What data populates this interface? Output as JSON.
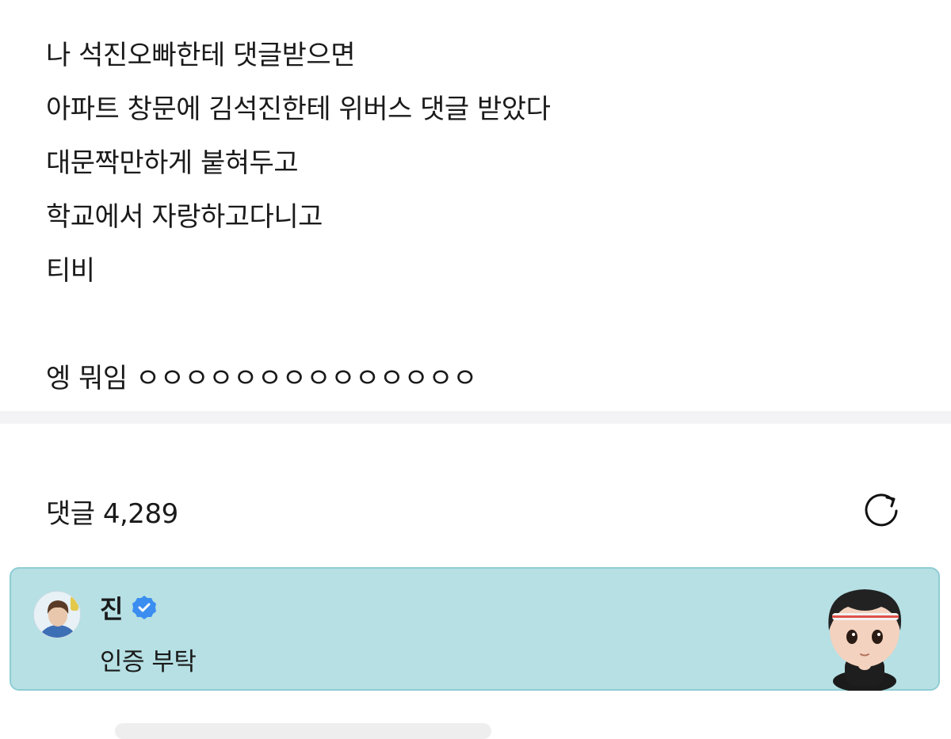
{
  "post": {
    "lines": [
      "나 석진오빠한테 댓글받으면",
      "아파트 창문에 김석진한테 위버스 댓글 받았다",
      "대문짝만하게 붙혀두고",
      "학교에서 자랑하고다니고",
      "티비",
      "",
      "엥 뭐임 ㅇㅇㅇㅇㅇㅇㅇㅇㅇㅇㅇㅇㅇㅇ"
    ]
  },
  "comments": {
    "label": "댓글 4,289",
    "refresh_icon": "refresh-icon"
  },
  "comment": {
    "author": "진",
    "verified_icon": "verified-badge-icon",
    "text": "인증 부탁",
    "card_color": "#b6e0e4",
    "verified_color": "#3b8ef0"
  }
}
